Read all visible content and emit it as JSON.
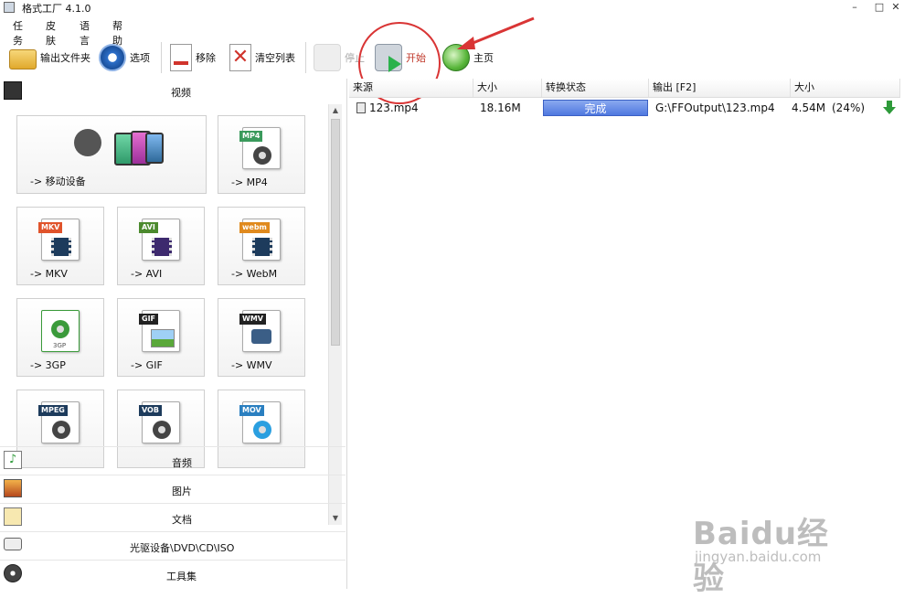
{
  "window": {
    "title": "格式工厂 4.1.0",
    "minimize": "–",
    "maximize": "□",
    "close": "✕"
  },
  "menu": [
    "任务",
    "皮肤",
    "语言",
    "帮助"
  ],
  "toolbar": {
    "output_folder": "输出文件夹",
    "options": "选项",
    "remove": "移除",
    "clear_list": "清空列表",
    "stop": "停止",
    "start": "开始",
    "home": "主页"
  },
  "left": {
    "video_header": "视频",
    "tiles": [
      {
        "label": "-> 移动设备",
        "badge": ""
      },
      {
        "label": "-> MP4",
        "badge": "MP4"
      },
      {
        "label": "-> MKV",
        "badge": "MKV"
      },
      {
        "label": "-> AVI",
        "badge": "AVI"
      },
      {
        "label": "-> WebM",
        "badge": "webm"
      },
      {
        "label": "-> 3GP",
        "badge": "3GP"
      },
      {
        "label": "-> GIF",
        "badge": "GIF"
      },
      {
        "label": "-> WMV",
        "badge": "WMV"
      },
      {
        "label": "",
        "badge": "MPEG"
      },
      {
        "label": "",
        "badge": "VOB"
      },
      {
        "label": "",
        "badge": "MOV"
      }
    ],
    "categories": [
      "音频",
      "图片",
      "文档",
      "光驱设备\\DVD\\CD\\ISO",
      "工具集"
    ]
  },
  "table": {
    "headers": [
      "来源",
      "大小",
      "转换状态",
      "输出 [F2]",
      "大小"
    ],
    "rows": [
      {
        "source": "123.mp4",
        "size": "18.16M",
        "status": "完成",
        "output": "G:\\FFOutput\\123.mp4",
        "out_size": "4.54M",
        "ratio": "(24%)"
      }
    ]
  },
  "watermark": {
    "brand": "Baidu经验",
    "url": "jingyan.baidu.com"
  },
  "colors": {
    "status_bar": "#4f78e0",
    "annotation_red": "#d93535",
    "start_text": "#c0392b"
  }
}
